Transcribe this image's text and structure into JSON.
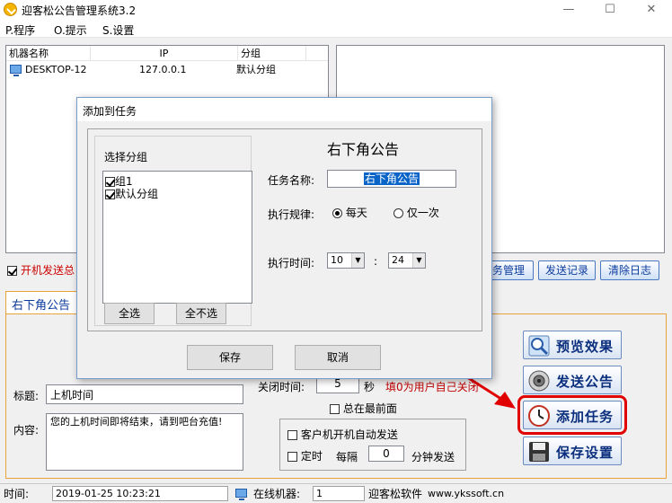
{
  "app": {
    "title": "迎客松公告管理系统3.2",
    "window_controls": {
      "minimize": "—",
      "maximize": "☐",
      "close": "✕"
    }
  },
  "menu": [
    {
      "label": "P.程序"
    },
    {
      "label": "O.提示"
    },
    {
      "label": "S.设置"
    }
  ],
  "machine_list": {
    "columns": [
      "机器名称",
      "IP",
      "分组"
    ],
    "rows": [
      {
        "name": "DESKTOP-12",
        "ip": "127.0.0.1",
        "group": "默认分组"
      }
    ]
  },
  "auto_send": {
    "label": "开机发送总",
    "checked": true
  },
  "toolbar": [
    {
      "label": "务管理"
    },
    {
      "label": "发送记录"
    },
    {
      "label": "清除日志"
    }
  ],
  "tab": {
    "label": "右下角公告"
  },
  "form": {
    "title_label": "标题:",
    "title_value": "上机时间",
    "content_label": "内容:",
    "content_value": "您的上机时间即将结束，请到吧台充值!",
    "close_time_label": "关闭时间:",
    "close_time_value": "5",
    "close_time_unit": "秒",
    "close_time_hint": "填0为用户自己关闭",
    "always_on_top": {
      "label": "总在最前面",
      "checked": false
    },
    "client_boot_send": {
      "label": "客户机开机自动发送",
      "checked": false
    },
    "timed": {
      "label": "定时",
      "checked": false
    },
    "interval_label": "每隔",
    "interval_value": "0",
    "interval_unit": "分钟发送"
  },
  "side_buttons": [
    {
      "label": "预览效果",
      "icon": "magnifier-icon"
    },
    {
      "label": "发送公告",
      "icon": "speaker-icon"
    },
    {
      "label": "添加任务",
      "icon": "clock-icon",
      "highlighted": true
    },
    {
      "label": "保存设置",
      "icon": "floppy-disk-icon"
    }
  ],
  "status_bar": {
    "time_label": "时间:",
    "time_value": "2019-01-25 10:23:21",
    "online_label": "在线机器:",
    "online_value": "1",
    "company": "迎客松软件",
    "website": "www.ykssoft.cn"
  },
  "dialog": {
    "title": "添加到任务",
    "group_section_label": "选择分组",
    "groups": [
      {
        "label": "组1",
        "checked": true
      },
      {
        "label": "默认分组",
        "checked": true
      }
    ],
    "select_all": "全选",
    "select_none": "全不选",
    "heading": "右下角公告",
    "task_name_label": "任务名称:",
    "task_name_value": "右下角公告",
    "rule_label": "执行规律:",
    "rule_options": [
      {
        "label": "每天",
        "selected": true
      },
      {
        "label": "仅一次",
        "selected": false
      }
    ],
    "time_label": "执行时间:",
    "hour_value": "10",
    "minute_value": "24",
    "time_separator": ":",
    "save": "保存",
    "cancel": "取消"
  },
  "colors": {
    "accent_blue": "#0b3b9e",
    "frame_orange": "#e8a33a",
    "highlight_red": "#e00000",
    "warning_red": "#c00000"
  }
}
